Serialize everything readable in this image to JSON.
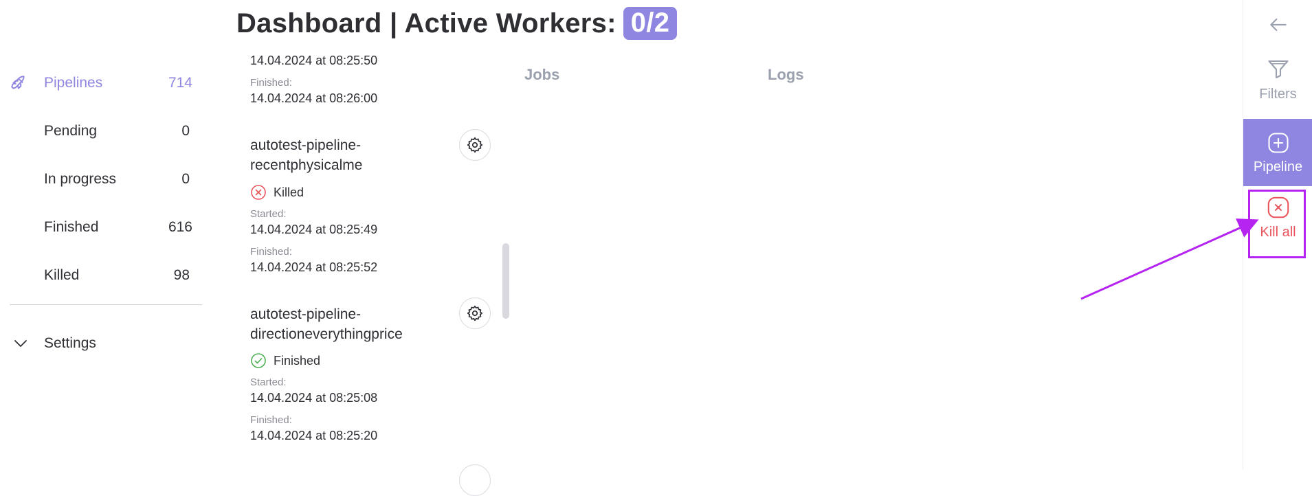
{
  "header": {
    "title": "Dashboard | Active Workers:",
    "workers_badge": "0/2"
  },
  "sidebar": {
    "items": [
      {
        "label": "Pipelines",
        "count": "714",
        "icon": "rocket-icon",
        "active": true
      },
      {
        "label": "Pending",
        "count": "0"
      },
      {
        "label": "In progress",
        "count": "0"
      },
      {
        "label": "Finished",
        "count": "616"
      },
      {
        "label": "Killed",
        "count": "98"
      }
    ],
    "settings_label": "Settings"
  },
  "pipelines": {
    "top_partial": {
      "started_value": "14.04.2024 at 08:25:50",
      "finished_label": "Finished:",
      "finished_value": "14.04.2024 at 08:26:00"
    },
    "items": [
      {
        "name_line1": "autotest-pipeline-",
        "name_line2": "recentphysicalme",
        "status": "Killed",
        "started_label": "Started:",
        "started_value": "14.04.2024 at 08:25:49",
        "finished_label": "Finished:",
        "finished_value": "14.04.2024 at 08:25:52"
      },
      {
        "name_line1": "autotest-pipeline-",
        "name_line2": "directioneverythingprice",
        "status": "Finished",
        "started_label": "Started:",
        "started_value": "14.04.2024 at 08:25:08",
        "finished_label": "Finished:",
        "finished_value": "14.04.2024 at 08:25:20"
      }
    ]
  },
  "tabs": [
    "Jobs",
    "Logs"
  ],
  "right_panel": {
    "back_icon": "arrow-left-icon",
    "filters_label": "Filters",
    "pipeline_label": "Pipeline",
    "kill_all_label": "Kill all"
  },
  "colors": {
    "accent": "#8e86e0",
    "killed": "#e9545c",
    "finished": "#4caf50",
    "annotation": "#b624f2"
  }
}
